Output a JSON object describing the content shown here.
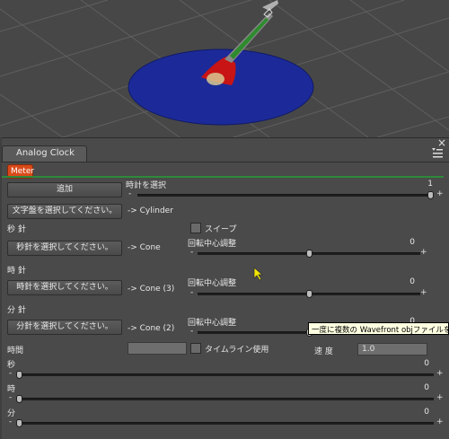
{
  "panel": {
    "title": "Analog Clock",
    "tab": "Meter",
    "close_glyph": "×",
    "menu_icon": "panel-menu-icon"
  },
  "meter": {
    "add_button": "追加",
    "select_clock_label": "時計を選択",
    "select_clock_value": "1",
    "dial_button": "文字盤を選択してください。",
    "dial_target": "-> Cylinder",
    "second_section": "秒 針",
    "second_button": "秒針を選択してください。",
    "second_target": "-> Cone",
    "sweep_label": "スイープ",
    "second_pivot_label": "回転中心調整",
    "second_pivot_value": "0",
    "minute_section": "時 針",
    "minute_button": "時針を選択してください。",
    "minute_target": "-> Cone (3)",
    "minute_pivot_label": "回転中心調整",
    "minute_pivot_value": "0",
    "hour_section": "分 針",
    "hour_button": "分針を選択してください。",
    "hour_target": "-> Cone (2)",
    "hour_pivot_label": "回転中心調整",
    "hour_pivot_value": "0",
    "time_label": "時間",
    "timeline_label": "タイムライン使用",
    "speed_label": "速 度",
    "speed_value": "1.0",
    "sec_label": "秒",
    "sec_value": "0",
    "hr_label": "時",
    "hr_value": "0",
    "min_label": "分",
    "min_value": "0",
    "tooltip": "一度に複数の Wavefront objファイルを"
  },
  "slider_levels": {
    "select_clock": 1.0,
    "second_pivot": 0.5,
    "minute_pivot": 0.5,
    "hour_pivot": 0.5,
    "sec": 0.0,
    "hr": 0.0,
    "min": 0.0
  },
  "colors": {
    "tab_accent": "#d94a1a",
    "divider": "#2d8a3a",
    "disc": "#1c2a99"
  }
}
